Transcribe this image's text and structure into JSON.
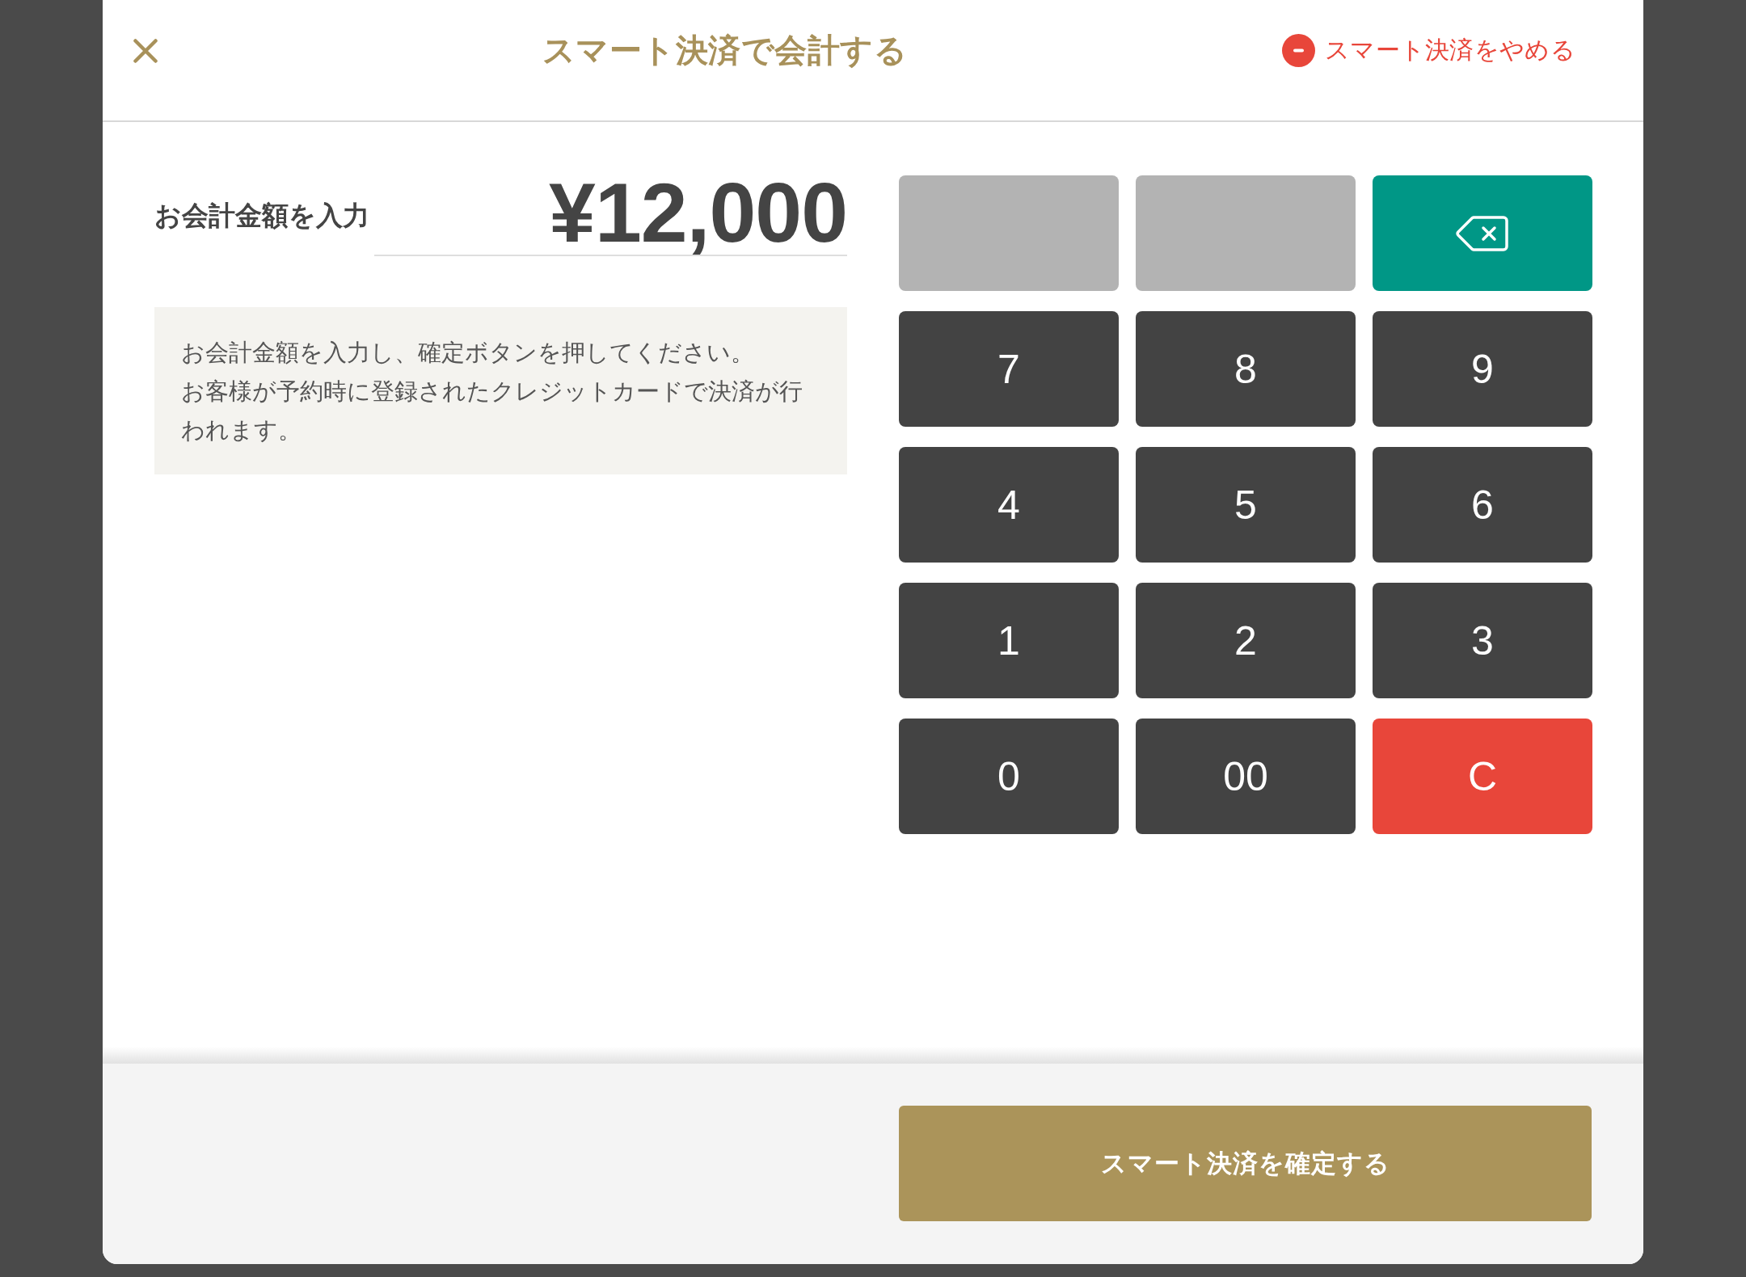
{
  "header": {
    "title": "スマート決済で会計する",
    "cancel_link": {
      "label": "スマート決済をやめる"
    }
  },
  "amount": {
    "label": "お会計金額を入力",
    "value": "¥12,000"
  },
  "notice": {
    "lines": [
      "お会計金額を入力し、確定ボタンを押してください。",
      "お客様が予約時に登録されたクレジットカードで決済が行われます。"
    ]
  },
  "keypad": {
    "keys": [
      {
        "kind": "blank"
      },
      {
        "kind": "blank"
      },
      {
        "kind": "backspace"
      },
      {
        "kind": "digit",
        "label": "7"
      },
      {
        "kind": "digit",
        "label": "8"
      },
      {
        "kind": "digit",
        "label": "9"
      },
      {
        "kind": "digit",
        "label": "4"
      },
      {
        "kind": "digit",
        "label": "5"
      },
      {
        "kind": "digit",
        "label": "6"
      },
      {
        "kind": "digit",
        "label": "1"
      },
      {
        "kind": "digit",
        "label": "2"
      },
      {
        "kind": "digit",
        "label": "3"
      },
      {
        "kind": "digit",
        "label": "0"
      },
      {
        "kind": "digit",
        "label": "00"
      },
      {
        "kind": "clear",
        "label": "C"
      }
    ]
  },
  "footer": {
    "confirm_button": {
      "label": "スマート決済を確定する"
    }
  }
}
